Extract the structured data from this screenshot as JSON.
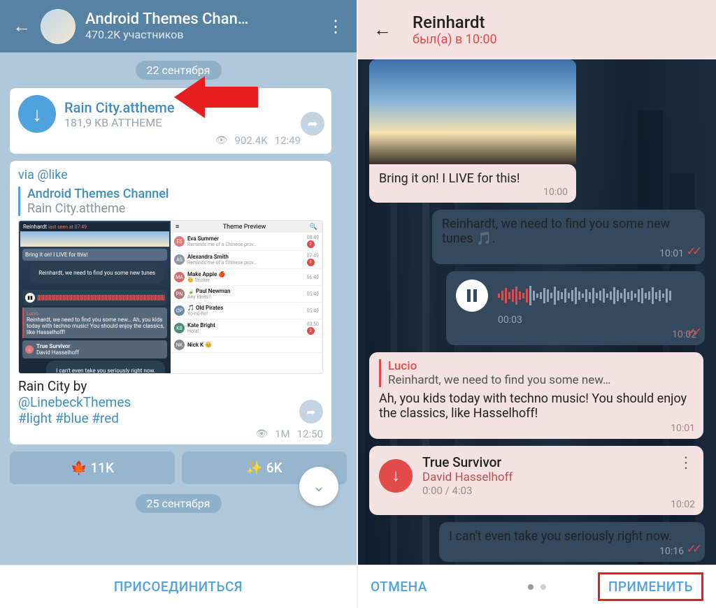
{
  "left": {
    "header": {
      "title": "Android Themes Chan…",
      "subtitle": "470.2K участников"
    },
    "date1": "22 сентября",
    "date2": "25 сентября",
    "file": {
      "name": "Rain City.attheme",
      "meta": "181,9 KB ATTHEME",
      "views": "902.4K",
      "time": "12:49"
    },
    "via": "via @like",
    "quote": {
      "channel": "Android Themes Channel",
      "file": "Rain City.attheme"
    },
    "preview": {
      "title": "Theme Preview",
      "reinhardt": "Reinhardt",
      "lastseen": "last seen at 07:49",
      "m1": "Bring it on! I LIVE for this!",
      "m2": "Reinhardt, we need to find you some new tunes",
      "m3": "Reinhardt, we need to find you some new…\nAh, you kids today with techno music! You should enjoy the classics, like Hasselhoff!",
      "m4": "True Survivor",
      "m4b": "David Hasselhoff",
      "m5": "I can't even take you seriously right now.",
      "lucio": "Lucio",
      "list": [
        {
          "av": "ES",
          "c": "#E07A7A",
          "name": "Eva Summer",
          "sub": "Reminds me of a Chinese prov…",
          "t": "08:49",
          "b": "2"
        },
        {
          "av": "AS",
          "c": "#8A97A6",
          "name": "Alexandra Smith",
          "sub": "Reminds me of a Chinese prov…",
          "t": "07:49",
          "b": "2"
        },
        {
          "av": "MA",
          "c": "#D46A6A",
          "name": "Make Apple 🍎",
          "sub": "😊 Sticker",
          "t": "06:49",
          "b": ""
        },
        {
          "av": "PN",
          "c": "#B57373",
          "name": "🍃 Paul Newman",
          "sub": "Any ideas?",
          "t": "05:49",
          "b": ""
        },
        {
          "av": "OP",
          "c": "#6C8AA8",
          "name": "🎵 Old Pirates",
          "sub": "Yo-ho-ho!",
          "t": "05:49",
          "b": ""
        },
        {
          "av": "KB",
          "c": "#4A8A6F",
          "name": "Kate Bright",
          "sub": "Hola!",
          "t": "03:50",
          "b": "2"
        },
        {
          "av": "NK",
          "c": "#888",
          "name": "Nick K 😊",
          "sub": "",
          "t": "",
          "b": ""
        }
      ]
    },
    "caption": {
      "text": "Rain City by",
      "link1": "@LinebeckThemes",
      "tags": "#light #blue #red",
      "views": "1M",
      "time": "12:50"
    },
    "votes": {
      "a": "🍁 11K",
      "b": "✨ 6K"
    },
    "join": "ПРИСОЕДИНИТЬСЯ"
  },
  "right": {
    "header": {
      "title": "Reinhardt",
      "subtitle": "был(а) в 10:00"
    },
    "m1": {
      "text": "Bring it on! I LIVE for this!",
      "time": "10:00"
    },
    "m2": {
      "text": "Reinhardt, we need to find you some new tunes 🎵.",
      "time": "10:01"
    },
    "audio": {
      "pos": "00:03",
      "time": "10:02"
    },
    "m3": {
      "qname": "Lucio",
      "qtext": "Reinhardt, we need to find you some new…",
      "text": "Ah, you kids today with techno music! You should enjoy the classics, like Hasselhoff!",
      "time": "10:01"
    },
    "file": {
      "title": "True Survivor",
      "artist": "David Hasselhoff",
      "dur": "0:00 / 4:03",
      "time": "10:02"
    },
    "m4": {
      "text": "I can't even take you seriously right now.",
      "time": "10:16"
    },
    "cancel": "ОТМЕНА",
    "apply": "ПРИМЕНИТЬ"
  }
}
